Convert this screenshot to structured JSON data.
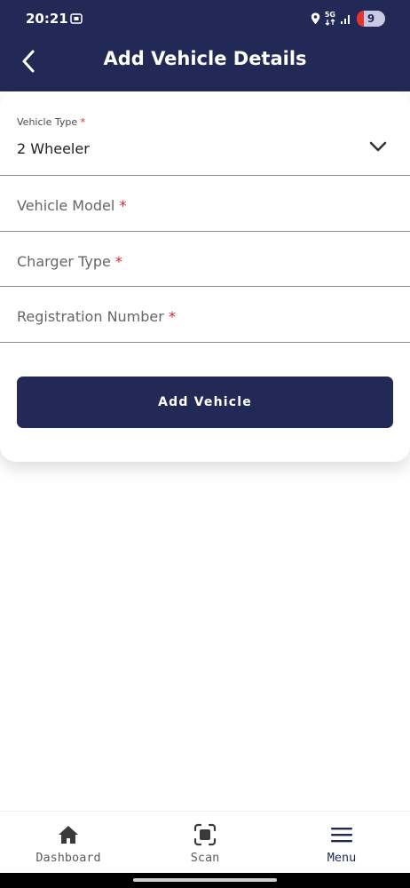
{
  "status_bar": {
    "time": "20:21",
    "network": "5G",
    "battery_level": "9",
    "icons": [
      "screen-record-icon",
      "location-icon",
      "network-5g-icon",
      "signal-icon",
      "battery-icon"
    ]
  },
  "header": {
    "title": "Add Vehicle Details",
    "back_icon": "chevron-left-icon",
    "background": "#232957"
  },
  "form": {
    "vehicle_type": {
      "label": "Vehicle Type",
      "required_mark": "*",
      "value": "2 Wheeler",
      "dropdown_icon": "chevron-down-icon"
    },
    "vehicle_model": {
      "placeholder": "Vehicle Model",
      "required_mark": "*"
    },
    "charger_type": {
      "placeholder": "Charger Type",
      "required_mark": "*"
    },
    "registration_number": {
      "placeholder": "Registration Number",
      "required_mark": "*"
    },
    "submit_label": "Add Vehicle"
  },
  "bottom_nav": {
    "items": [
      {
        "label": "Dashboard",
        "icon": "home-icon"
      },
      {
        "label": "Scan",
        "icon": "scan-icon"
      },
      {
        "label": "Menu",
        "icon": "menu-icon",
        "active": true
      }
    ]
  },
  "colors": {
    "primary": "#232957",
    "required": "#d8232a",
    "divider": "#8d8d8d"
  }
}
